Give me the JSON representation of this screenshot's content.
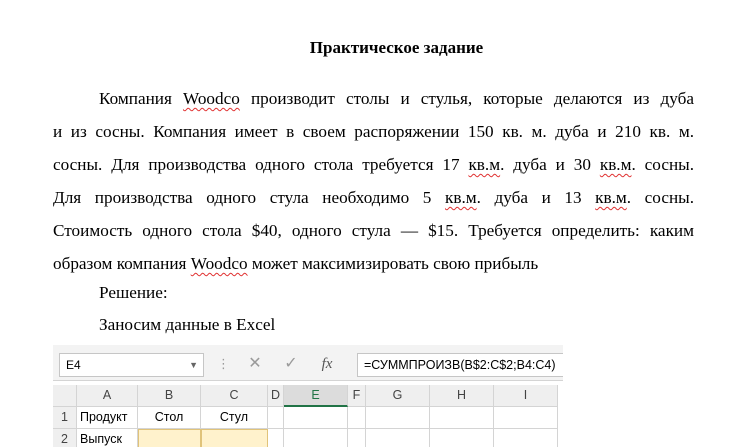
{
  "document": {
    "title": "Практическое задание",
    "paragraph_lines": [
      [
        "Компания ",
        "Woodco",
        " производит столы и стулья, которые делаются из дуба"
      ],
      [
        "и из сосны. Компания имеет в своем распоряжении 150 кв. м. дуба и 210 кв. м."
      ],
      [
        "сосны. Для производства одного стола требуется 17 ",
        "кв.м",
        ". дуба и 30 ",
        "кв.м",
        ". сосны."
      ],
      [
        "Для производства одного стула необходимо 5 ",
        "кв.м",
        ". дуба и 13 ",
        "кв.м",
        ". сосны."
      ],
      [
        "Стоимость одного стола $40, одного стула — $15. Требуется определить: каким"
      ],
      [
        "образом компания ",
        "Woodco",
        " может максимизировать свою прибыль"
      ]
    ],
    "solution_label": "Решение:",
    "excel_intro": "Заносим данные в Excel"
  },
  "excel": {
    "name_box": "E4",
    "formula": "=СУММПРОИЗВ(B$2:C$2;B4:C4)",
    "buttons": {
      "cancel": "✕",
      "enter": "✓",
      "function": "fx"
    },
    "columns": [
      "A",
      "B",
      "C",
      "D",
      "E",
      "F",
      "G",
      "H",
      "I"
    ],
    "rows": [
      {
        "num": "1",
        "A": "Продукт",
        "B": "Стол",
        "C": "Стул"
      },
      {
        "num": "2",
        "A": "Выпуск",
        "B": "",
        "C": ""
      }
    ]
  }
}
